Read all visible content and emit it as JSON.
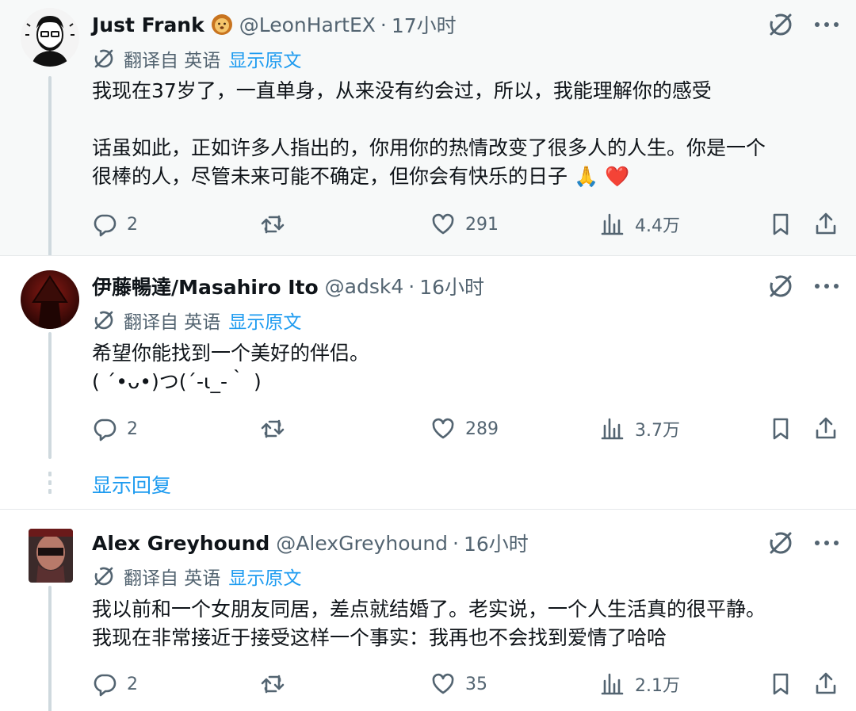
{
  "translate": {
    "prefix": "翻译自 英语",
    "show_original": "显示原文"
  },
  "tweets": [
    {
      "name": "Just Frank",
      "handle": "@LeonHartEX",
      "sep": "·",
      "time": "17小时",
      "lines": [
        "我现在37岁了，一直单身，从来没有约会过，所以，我能理解你的感受",
        "",
        "话虽如此，正如许多人指出的，你用你的热情改变了很多人的人生。你是一个",
        "很棒的人，尽管未来可能不确定，但你会有快乐的日子 🙏 ❤️"
      ],
      "replies": "2",
      "likes": "291",
      "views": "4.4万"
    },
    {
      "name": "伊藤暢達/Masahiro Ito",
      "handle": "@adsk4",
      "sep": "·",
      "time": "16小时",
      "lines": [
        "希望你能找到一个美好的伴侣。",
        "( ´•ᴗ•)つ(´-ι_-｀ )"
      ],
      "replies": "2",
      "likes": "289",
      "views": "3.7万"
    },
    {
      "name": "Alex Greyhound",
      "handle": "@AlexGreyhound",
      "sep": "·",
      "time": "16小时",
      "lines": [
        "我以前和一个女朋友同居，差点就结婚了。老实说，一个人生活真的很平静。",
        "我现在非常接近于接受这样一个事实：我再也不会找到爱情了哈哈"
      ],
      "replies": "2",
      "likes": "35",
      "views": "2.1万"
    }
  ],
  "show_replies": "显示回复",
  "colors": {
    "text": "#0f1419",
    "secondary": "#536471",
    "link": "#1d9bf0",
    "highlight_bg": "#f7f9f9",
    "thread_line": "#cfd9de"
  }
}
